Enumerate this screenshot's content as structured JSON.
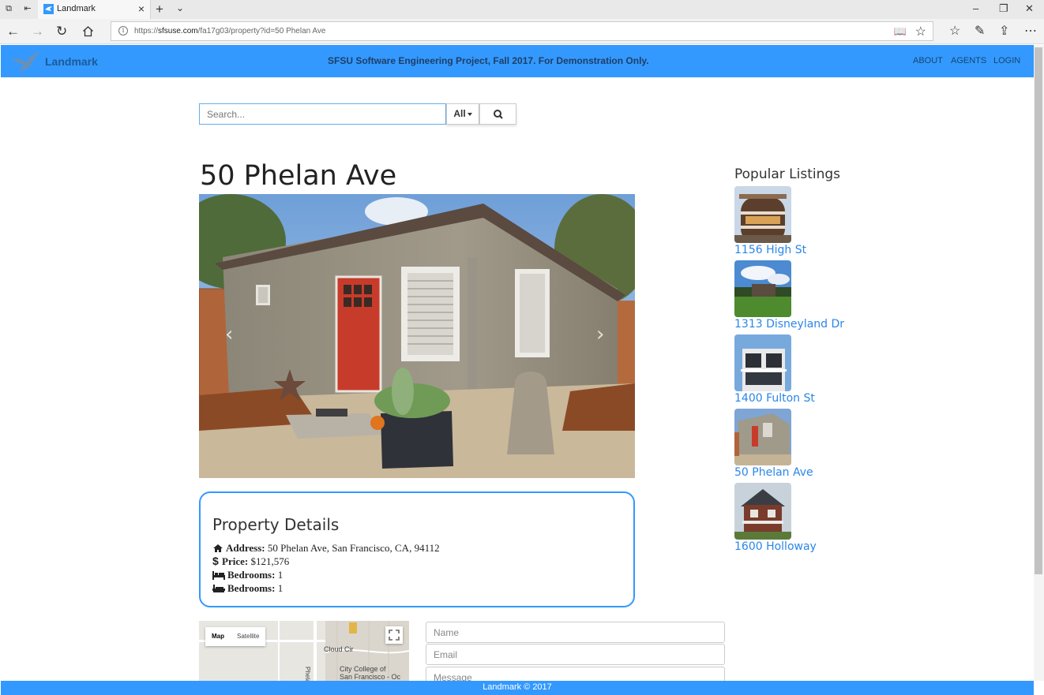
{
  "browser": {
    "tab_title": "Landmark",
    "url_prefix": "https://",
    "url_domain": "sfsuse.com",
    "url_path": "/fa17g03/property?id=50 Phelan Ave"
  },
  "header": {
    "brand": "Landmark",
    "banner": "SFSU Software Engineering Project, Fall 2017. For Demonstration Only.",
    "nav": [
      "ABOUT",
      "AGENTS",
      "LOGIN"
    ],
    "color": "#3399ff"
  },
  "search": {
    "placeholder": "Search...",
    "filter": "All"
  },
  "property": {
    "title": "50 Phelan Ave",
    "details_heading": "Property Details",
    "address_label": "Address:",
    "address": "50 Phelan Ave, San Francisco, CA, 94112",
    "price_label": "Price:",
    "price": "$121,576",
    "bedrooms_label": "Bedrooms:",
    "bedrooms": "1",
    "bedrooms2_label": "Bedrooms:",
    "bedrooms2": "1"
  },
  "map": {
    "tab_map": "Map",
    "tab_satellite": "Satellite",
    "label_street": "Cloud Cir",
    "label_college": "City College of",
    "label_college2": "San Francisco - Oc",
    "label_phelan": "Phelan"
  },
  "contact": {
    "name_placeholder": "Name",
    "email_placeholder": "Email",
    "message_placeholder": "Message"
  },
  "sidebar": {
    "title": "Popular Listings",
    "items": [
      {
        "label": "1156 High St",
        "icon": "round-tower-house-photo"
      },
      {
        "label": "1313 Disneyland Dr",
        "icon": "mansion-lawn-photo"
      },
      {
        "label": "1400 Fulton St",
        "icon": "modern-house-photo"
      },
      {
        "label": "50 Phelan Ave",
        "icon": "cottage-red-door-photo"
      },
      {
        "label": "1600 Holloway",
        "icon": "craftsman-house-photo"
      }
    ]
  },
  "footer": {
    "text": "Landmark © 2017"
  }
}
